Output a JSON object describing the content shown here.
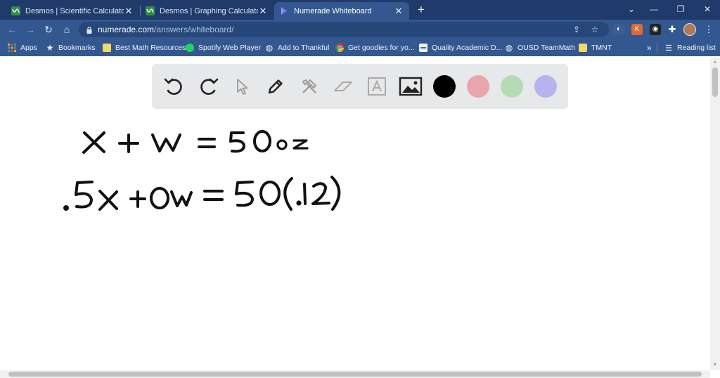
{
  "browser": {
    "tabs": [
      {
        "title": "Desmos | Scientific Calculator",
        "active": false,
        "favicon": "desmos-icon"
      },
      {
        "title": "Desmos | Graphing Calculator",
        "active": false,
        "favicon": "desmos-icon"
      },
      {
        "title": "Numerade Whiteboard",
        "active": true,
        "favicon": "numerade-icon"
      }
    ],
    "new_tab_label": "+",
    "address": {
      "host": "numerade.com",
      "path": "/answers/whiteboard/"
    },
    "bookmarks": [
      {
        "label": "Apps",
        "icon": "apps-grid-icon"
      },
      {
        "label": "Bookmarks",
        "icon": "star-icon"
      },
      {
        "label": "Best Math Resources",
        "icon": "folder-icon"
      },
      {
        "label": "Spotify Web Player",
        "icon": "spotify-icon"
      },
      {
        "label": "Add to Thankful",
        "icon": "globe-icon"
      },
      {
        "label": "Get goodies for yo...",
        "icon": "chrome-icon"
      },
      {
        "label": "Quality Academic D...",
        "icon": "doc-icon"
      },
      {
        "label": "OUSD TeamMath",
        "icon": "globe-icon"
      },
      {
        "label": "TMNT",
        "icon": "folder-icon"
      }
    ],
    "bookmarks_overflow": "»",
    "reading_list": "Reading list"
  },
  "whiteboard": {
    "tools": [
      "undo-icon",
      "redo-icon",
      "pointer-icon",
      "pen-icon",
      "tools-icon",
      "eraser-icon",
      "text-icon",
      "image-icon"
    ],
    "colors": [
      "#000000",
      "#e8a5ab",
      "#b5dbb4",
      "#b7b3ec"
    ],
    "handwriting": {
      "line1": "X + W = 50 oz",
      "line2": ".5X + 0W = 50(.12)"
    }
  }
}
